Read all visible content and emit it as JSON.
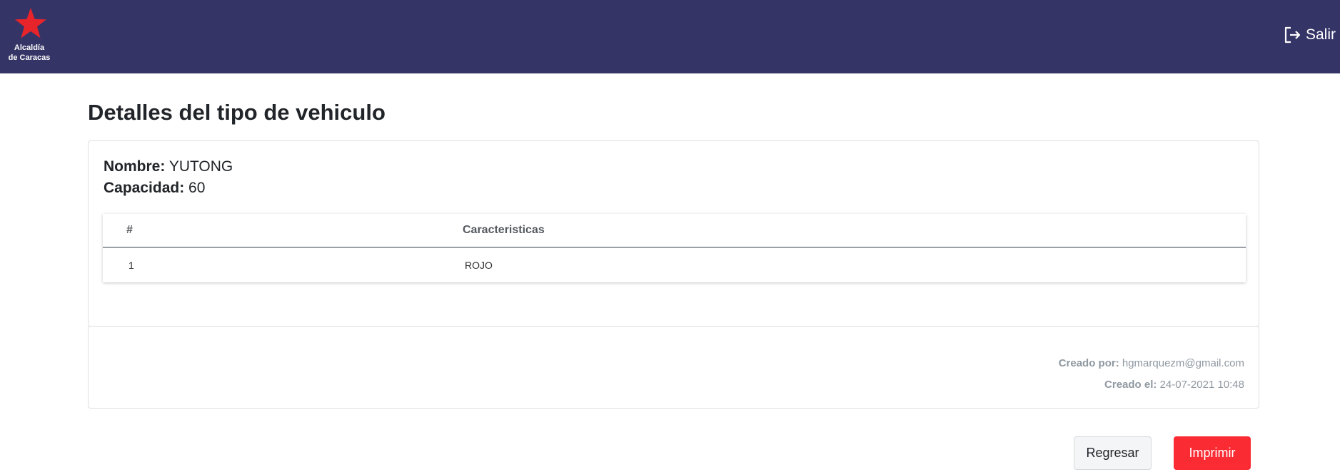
{
  "header": {
    "logo_line1": "Alcaldía",
    "logo_line2": "de Caracas",
    "logout_label": "Salir"
  },
  "page": {
    "title": "Detalles del tipo de vehiculo"
  },
  "vehicle": {
    "nombre_label": "Nombre:",
    "nombre_value": "YUTONG",
    "capacidad_label": "Capacidad:",
    "capacidad_value": "60"
  },
  "table": {
    "columns": [
      "#",
      "Caracteristicas"
    ],
    "rows": [
      {
        "num": "1",
        "caracteristica": "ROJO"
      }
    ]
  },
  "footer": {
    "creado_por_label": "Creado por:",
    "creado_por_value": "hgmarquezm@gmail.com",
    "creado_el_label": "Creado el:",
    "creado_el_value": "24-07-2021 10:48"
  },
  "actions": {
    "regresar_label": "Regresar",
    "imprimir_label": "Imprimir"
  },
  "colors": {
    "topbar": "#353467",
    "logo_star": "#e8242b",
    "primary_button": "#fb2b34"
  },
  "icons": {
    "logo": "star-icon",
    "logout": "logout-icon"
  }
}
